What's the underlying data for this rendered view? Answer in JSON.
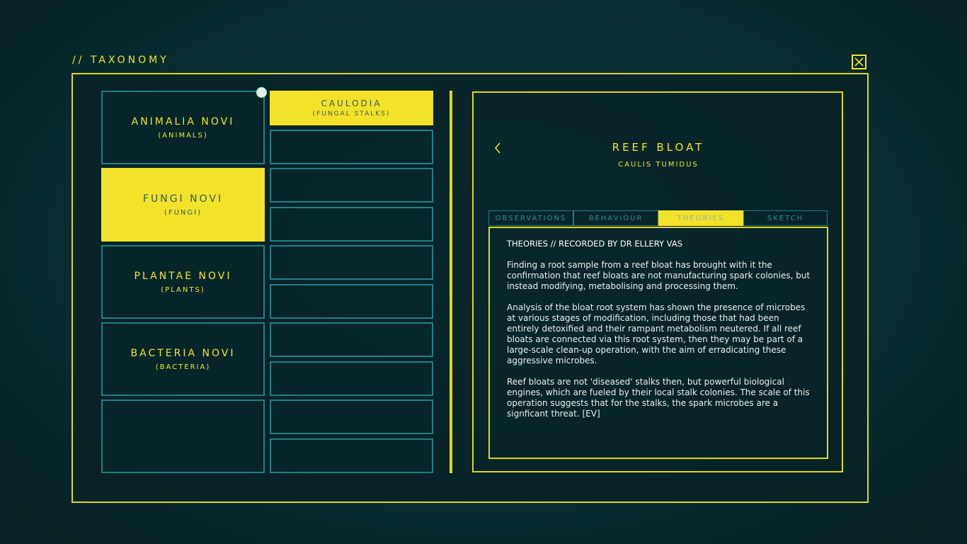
{
  "window": {
    "title": "// TAXONOMY",
    "close_icon": "close-x-icon"
  },
  "categories": [
    {
      "name": "ANIMALIA NOVI",
      "sub": "(ANIMALS)",
      "active": false
    },
    {
      "name": "FUNGI NOVI",
      "sub": "(FUNGI)",
      "active": true
    },
    {
      "name": "PLANTAE NOVI",
      "sub": "(PLANTS)",
      "active": false
    },
    {
      "name": "BACTERIA NOVI",
      "sub": "(BACTERIA)",
      "active": false
    },
    {
      "name": "",
      "sub": "",
      "active": false
    }
  ],
  "subcategories": [
    {
      "name": "CAULODIA",
      "sub": "(FUNGAL STALKS)",
      "active": true
    },
    {
      "name": "",
      "sub": ""
    },
    {
      "name": "",
      "sub": ""
    },
    {
      "name": "",
      "sub": ""
    },
    {
      "name": "",
      "sub": ""
    },
    {
      "name": "",
      "sub": ""
    },
    {
      "name": "",
      "sub": ""
    },
    {
      "name": "",
      "sub": ""
    },
    {
      "name": "",
      "sub": ""
    },
    {
      "name": "",
      "sub": ""
    }
  ],
  "species": {
    "name": "REEF BLOAT",
    "latin": "CAULIS TUMIDUS"
  },
  "tabs": [
    {
      "label": "OBSERVATIONS",
      "active": false
    },
    {
      "label": "BEHAVIOUR",
      "active": false
    },
    {
      "label": "THEORIES",
      "active": true
    },
    {
      "label": "SKETCH",
      "active": false
    }
  ],
  "entry": {
    "heading": "THEORIES // RECORDED BY DR ELLERY VAS",
    "paragraphs": [
      "Finding a root sample from a reef bloat has brought with it the confirmation that reef bloats are not manufacturing spark colonies, but instead modifying, metabolising and processing them.",
      "Analysis of the bloat root system has shown the presence of microbes at various stages of modification, including those that had been entirely detoxified and their rampant metabolism neutered. If all reef bloats are connected via this root system, then they may be part of a large-scale clean-up operation, with the aim of erradicating these aggressive microbes.",
      "Reef bloats are not 'diseased' stalks then, but powerful biological engines, which are fueled by their local stalk colonies. The scale of this operation suggests that for the stalks, the spark microbes are a signficant threat. [EV]"
    ]
  },
  "colors": {
    "accent": "#f2e32a",
    "border_teal": "#1f7f86",
    "background": "#0a2d31"
  }
}
